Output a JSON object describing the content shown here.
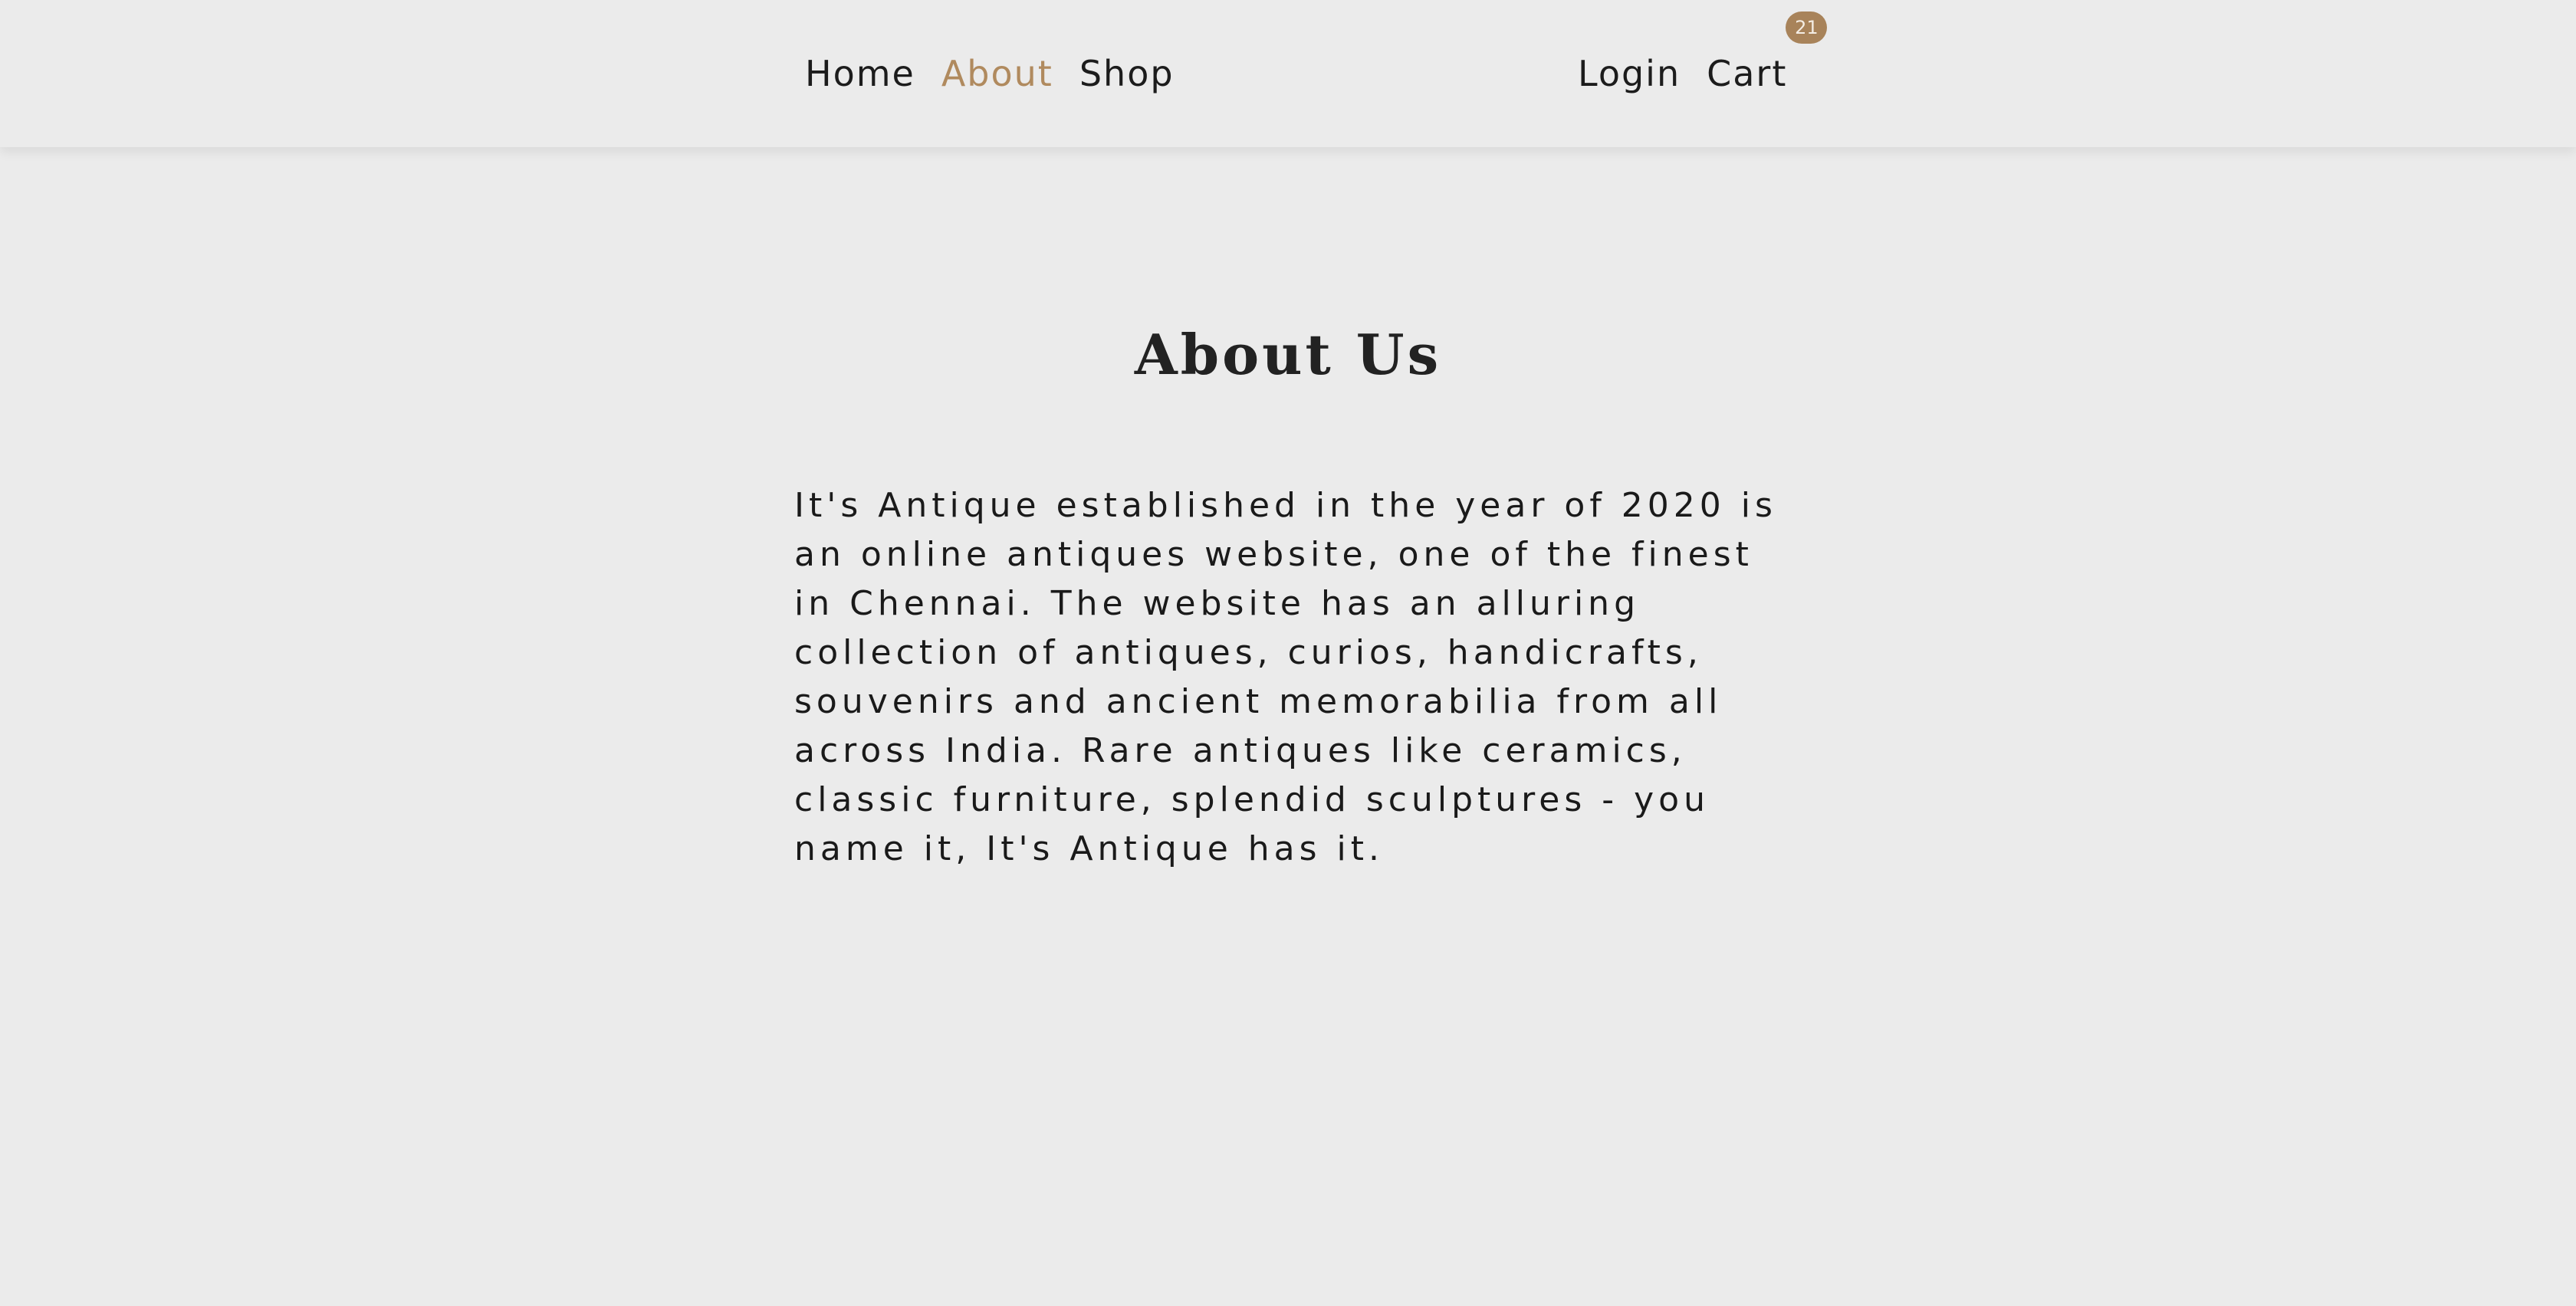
{
  "nav": {
    "home": "Home",
    "about": "About",
    "shop": "Shop",
    "login": "Login",
    "cart": "Cart",
    "cart_count": "21"
  },
  "main": {
    "title": "About Us",
    "description": "It's Antique established in the year of 2020 is an online antiques website, one of the finest in Chennai. The website has an alluring collection of antiques, curios, handicrafts, souvenirs and ancient memorabilia from all across India. Rare antiques like ceramics, classic furniture, splendid sculptures - you name it, It's Antique has it."
  },
  "colors": {
    "background": "#ebebeb",
    "accent": "#b08a5e",
    "badge": "#a8835a"
  }
}
